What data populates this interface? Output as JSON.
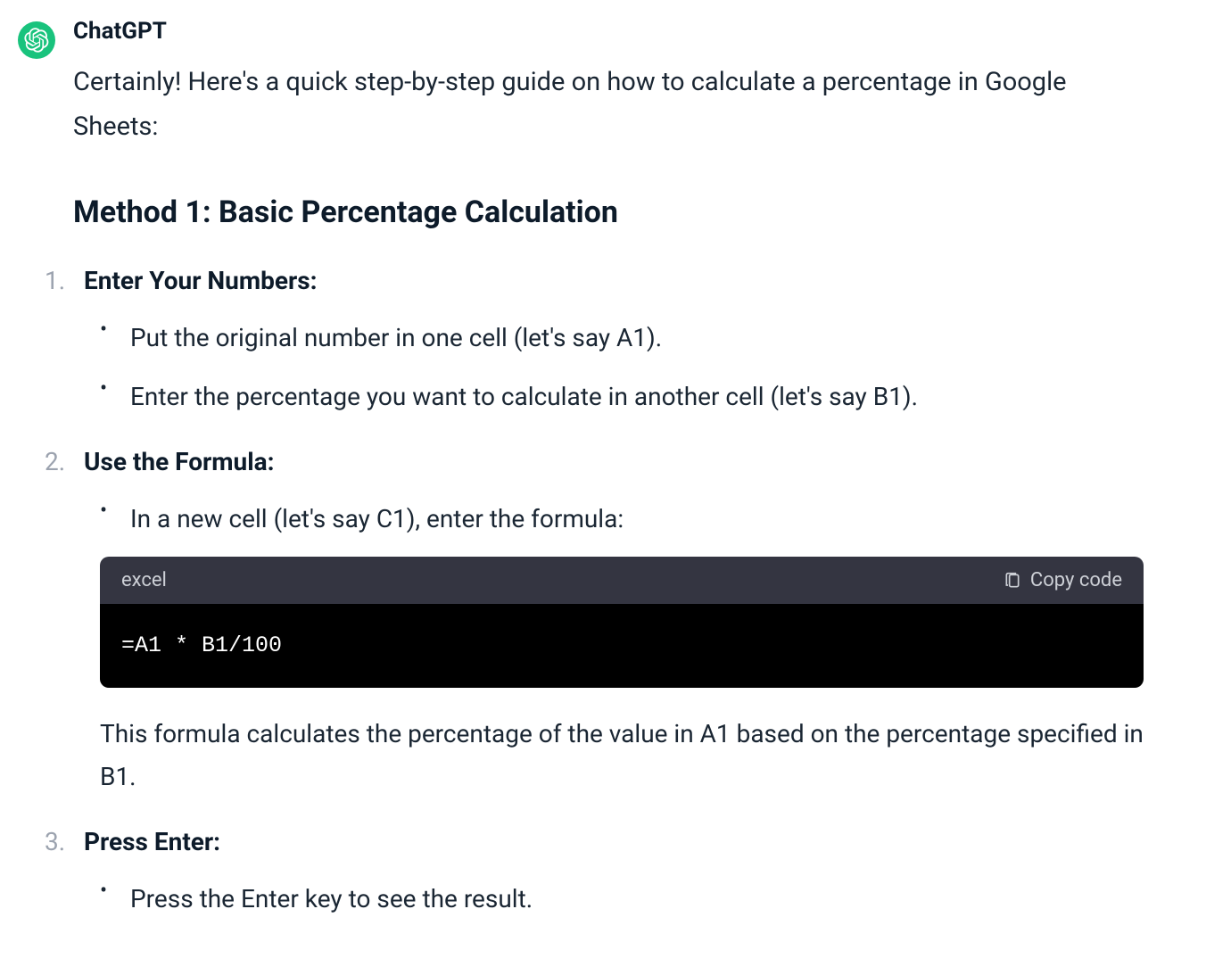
{
  "author": "ChatGPT",
  "intro": "Certainly! Here's a quick step-by-step guide on how to calculate a percentage in Google Sheets:",
  "method_heading": "Method 1: Basic Percentage Calculation",
  "steps": [
    {
      "number": "1.",
      "title": "Enter Your Numbers:",
      "bullets": [
        "Put the original number in one cell (let's say A1).",
        "Enter the percentage you want to calculate in another cell (let's say B1)."
      ]
    },
    {
      "number": "2.",
      "title": "Use the Formula:",
      "bullets": [
        "In a new cell (let's say C1), enter the formula:"
      ],
      "code": {
        "lang": "excel",
        "copy_label": "Copy code",
        "content": "=A1 * B1/100"
      },
      "explanation": "This formula calculates the percentage of the value in A1 based on the percentage specified in B1."
    },
    {
      "number": "3.",
      "title": "Press Enter:",
      "bullets": [
        "Press the Enter key to see the result."
      ]
    }
  ]
}
